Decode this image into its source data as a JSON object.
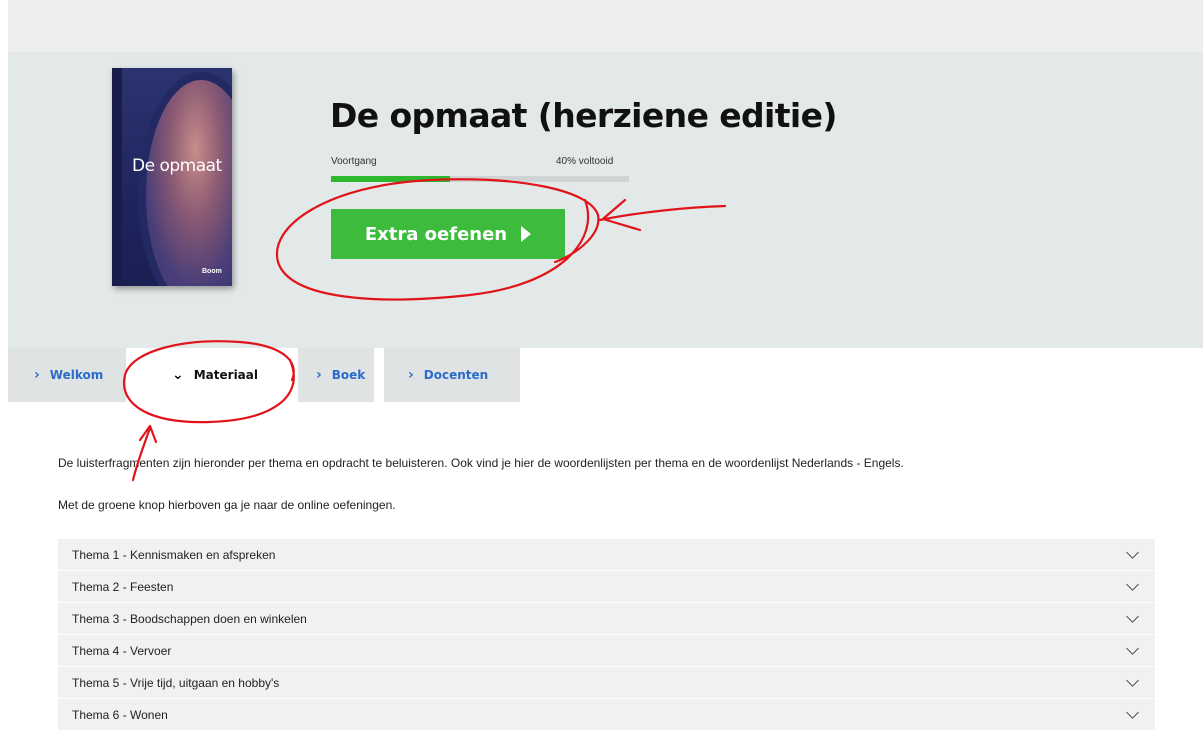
{
  "course": {
    "title": "De opmaat (herziene editie)",
    "cover_title": "De opmaat",
    "cover_logo": "Boom",
    "progress_label": "Voortgang",
    "progress_text": "40% voltooid",
    "progress_value": 0.4
  },
  "cta": {
    "label": "Extra oefenen"
  },
  "tabs": [
    {
      "label": "Welkom"
    },
    {
      "label": "Materiaal"
    },
    {
      "label": "Boek"
    },
    {
      "label": "Docenten"
    }
  ],
  "content": {
    "intro": "De luisterfragmenten zijn hieronder per thema en opdracht te beluisteren. Ook vind je hier de woordenlijsten per thema en de woordenlijst Nederlands - Engels.",
    "note": "Met de groene knop hierboven ga je naar de online oefeningen."
  },
  "themes": [
    "Thema 1 - Kennismaken en afspreken",
    "Thema 2 - Feesten",
    "Thema 3 - Boodschappen doen en winkelen",
    "Thema 4 - Vervoer",
    "Thema 5 - Vrije tijd, uitgaan en hobby's",
    "Thema 6 - Wonen"
  ],
  "colors": {
    "accent_green": "#3dbb3d",
    "link_blue": "#2a6cc9",
    "annotation_red": "#e0141a"
  }
}
